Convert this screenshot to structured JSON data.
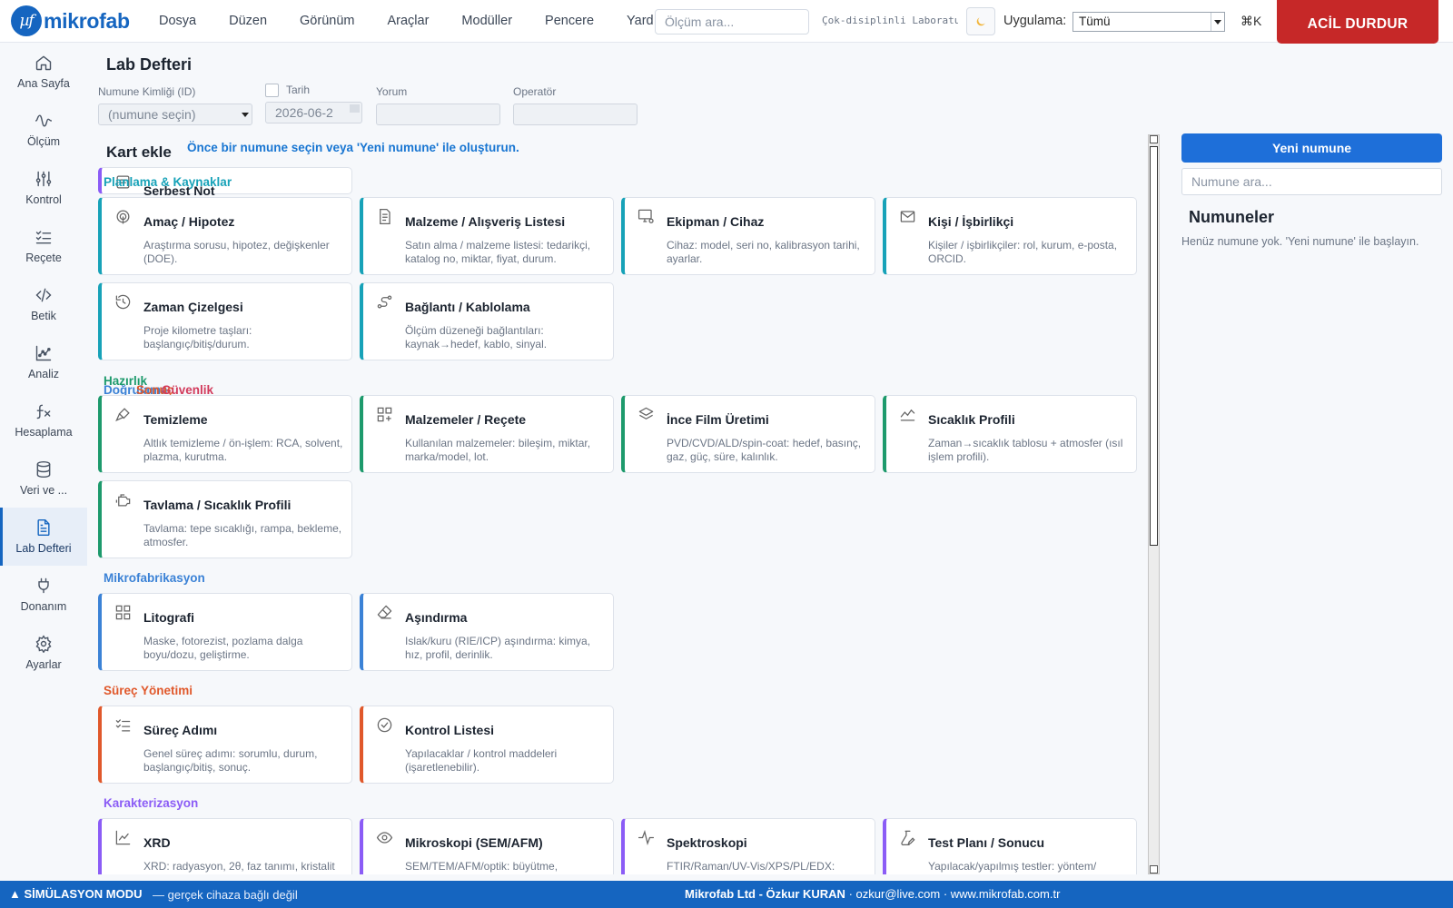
{
  "brand": {
    "logo_mark": "µf",
    "name": "mikrofab",
    "color": "#1565c0"
  },
  "menu": [
    "Dosya",
    "Düzen",
    "Görünüm",
    "Araçlar",
    "Modüller",
    "Pencere",
    "Yardım"
  ],
  "topbar": {
    "search_placeholder": "Ölçüm ara...",
    "lab_name": "Çok-disiplinli Laboratuvar",
    "theme_icon": "moon-icon",
    "app_label": "Uygulama:",
    "app_value": "Tümü",
    "shortcut": "⌘K",
    "estop_label": "ACİL DURDUR",
    "estop_color": "#c62828"
  },
  "sidebar": {
    "active_index": 7,
    "items": [
      {
        "label": "Ana Sayfa",
        "icon": "home-icon"
      },
      {
        "label": "Ölçüm",
        "icon": "waveform-icon"
      },
      {
        "label": "Kontrol",
        "icon": "sliders-icon"
      },
      {
        "label": "Reçete",
        "icon": "checklist-icon"
      },
      {
        "label": "Betik",
        "icon": "code-icon"
      },
      {
        "label": "Analiz",
        "icon": "chart-icon"
      },
      {
        "label": "Hesaplama",
        "icon": "function-icon"
      },
      {
        "label": "Veri ve ...",
        "icon": "database-icon"
      },
      {
        "label": "Lab Defteri",
        "icon": "document-icon"
      },
      {
        "label": "Donanım",
        "icon": "plug-icon"
      },
      {
        "label": "Ayarlar",
        "icon": "gear-icon"
      }
    ]
  },
  "page": {
    "title": "Lab Defteri"
  },
  "form": {
    "sample_label": "Numune Kimliği (ID)",
    "sample_placeholder": "(numune seçin)",
    "date_label": "Tarih",
    "date_value": "2026-06-2",
    "comment_label": "Yorum",
    "operator_label": "Operatör"
  },
  "add_card": {
    "title": "Kart ekle",
    "hint": "Önce bir numune seçin veya 'Yeni numune' ile oluşturun."
  },
  "overlap": {
    "free_note": "Serbest Not",
    "stacked_labels": [
      "Hazırlık",
      "Doğrulama",
      "Sonuç",
      "Güvenlik"
    ]
  },
  "categories": [
    {
      "name": "Planlama & Kaynaklar",
      "color": "#17a2b8",
      "cards": [
        {
          "title": "Amaç / Hipotez",
          "desc": "Araştırma sorusu, hipotez, değişkenler (DOE).",
          "icon": "target-icon"
        },
        {
          "title": "Malzeme / Alışveriş Listesi",
          "desc": "Satın alma / malzeme listesi: tedarikçi, katalog no, miktar, fiyat, durum.",
          "icon": "receipt-icon"
        },
        {
          "title": "Ekipman / Cihaz",
          "desc": "Cihaz: model, seri no, kalibrasyon tarihi, ayarlar.",
          "icon": "monitor-gear-icon"
        },
        {
          "title": "Kişi / İşbirlikçi",
          "desc": "Kişiler / işbirlikçiler: rol, kurum, e-posta, ORCID.",
          "icon": "mail-icon"
        },
        {
          "title": "Zaman Çizelgesi",
          "desc": "Proje kilometre taşları: başlangıç/bitiş/durum.",
          "icon": "history-icon"
        },
        {
          "title": "Bağlantı / Kablolama",
          "desc": "Ölçüm düzeneği bağlantıları: kaynak→hedef, kablo, sinyal.",
          "icon": "route-icon"
        }
      ]
    },
    {
      "name": "Hazırlık",
      "color": "#1d9a6c",
      "cards": [
        {
          "title": "Temizleme",
          "desc": "Altlık temizleme / ön-işlem: RCA, solvent, plazma, kurutma.",
          "icon": "brush-icon"
        },
        {
          "title": "Malzemeler / Reçete",
          "desc": "Kullanılan malzemeler: bileşim, miktar, marka/model, lot.",
          "icon": "grid-plus-icon"
        },
        {
          "title": "İnce Film Üretimi",
          "desc": "PVD/CVD/ALD/spin-coat: hedef, basınç, gaz, güç, süre, kalınlık.",
          "icon": "layers-icon"
        },
        {
          "title": "Sıcaklık Profili",
          "desc": "Zaman→sıcaklık tablosu + atmosfer (ısıl işlem profili).",
          "icon": "line-chart-icon"
        },
        {
          "title": "Tavlama / Sıcaklık Profili",
          "desc": "Tavlama: tepe sıcaklığı, rampa, bekleme, atmosfer.",
          "icon": "engine-icon"
        }
      ]
    },
    {
      "name": "Mikrofabrikasyon",
      "color": "#3b82d6",
      "cards": [
        {
          "title": "Litografi",
          "desc": "Maske, fotorezist, pozlama dalga boyu/dozu, geliştirme.",
          "icon": "grid-icon"
        },
        {
          "title": "Aşındırma",
          "desc": "Islak/kuru (RIE/ICP) aşındırma: kimya, hız, profil, derinlik.",
          "icon": "eraser-icon"
        }
      ]
    },
    {
      "name": "Süreç Yönetimi",
      "color": "#e0582b",
      "cards": [
        {
          "title": "Süreç Adımı",
          "desc": "Genel süreç adımı: sorumlu, durum, başlangıç/bitiş, sonuç.",
          "icon": "list-check-icon"
        },
        {
          "title": "Kontrol Listesi",
          "desc": "Yapılacaklar / kontrol maddeleri (işaretlenebilir).",
          "icon": "check-circle-icon"
        }
      ]
    },
    {
      "name": "Karakterizasyon",
      "color": "#8b5cf6",
      "cards": [
        {
          "title": "XRD",
          "desc": "XRD: radyasyon, 2θ, faz tanımı, kristalit",
          "icon": "scatter-icon"
        },
        {
          "title": "Mikroskopi (SEM/AFM)",
          "desc": "SEM/TEM/AFM/optik: büyütme,",
          "icon": "eye-icon"
        },
        {
          "title": "Spektroskopi",
          "desc": "FTIR/Raman/UV-Vis/XPS/PL/EDX:",
          "icon": "pulse-icon"
        },
        {
          "title": "Test Planı / Sonucu",
          "desc": "Yapılacak/yapılmış testler: yöntem/",
          "icon": "flask-pen-icon"
        }
      ]
    }
  ],
  "right_panel": {
    "new_button": "Yeni numune",
    "search_placeholder": "Numune ara...",
    "title": "Numuneler",
    "empty_text": "Henüz numune yok. 'Yeni numune' ile başlayın."
  },
  "statusbar": {
    "mode": "SİMÜLASYON MODU",
    "mode_sub": "— gerçek cihaza bağlı değil",
    "company": "Mikrofab Ltd - Özkur KURAN",
    "email": "ozkur@live.com",
    "website": "www.mikrofab.com.tr",
    "color": "#1565c0"
  }
}
